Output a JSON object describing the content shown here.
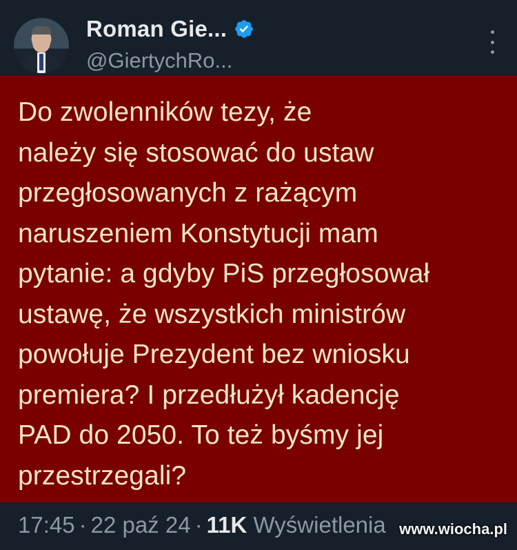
{
  "author": {
    "display_name": "Roman Gie...",
    "handle": "@GiertychRo...",
    "verified_icon": "verified-badge-icon",
    "verified_color": "#1d9bf0"
  },
  "tweet": {
    "text": "Do zwolenników tezy, że\nnależy się stosować do ustaw\nprzegłosowanych z rażącym\nnaruszeniem Konstytucji mam\npytanie: a gdyby PiS przegłosował\nustawę, że wszystkich ministrów\npowołuje Prezydent bez wniosku\npremiera? I przedłużył kadencję\nPAD do 2050. To też byśmy jej\nprzestrzegali?",
    "background_color": "#7a0000",
    "text_color": "#f3e6c6"
  },
  "meta": {
    "time": "17:45",
    "separator": "·",
    "date": "22 paź 24",
    "views_count": "11K",
    "views_label": "Wyświetlenia"
  },
  "watermark": {
    "text": "www.wiocha.pl"
  },
  "menu": {
    "icon": "more-options-icon"
  }
}
